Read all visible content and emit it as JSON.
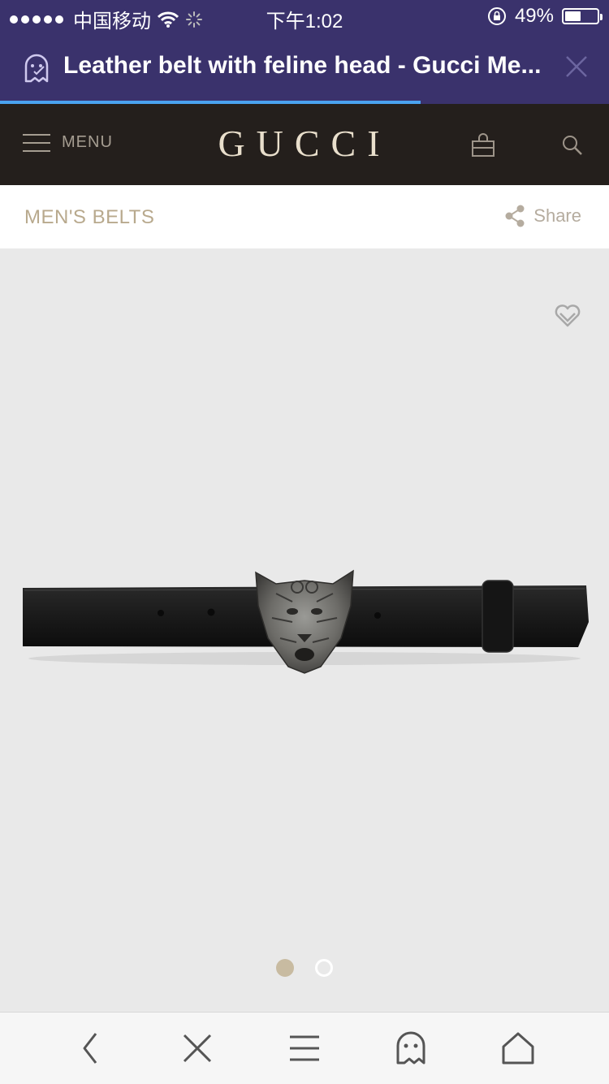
{
  "status_bar": {
    "carrier": "中国移动",
    "time": "下午1:02",
    "battery": "49%",
    "battery_level": 0.49
  },
  "browser": {
    "page_title": "Leather belt with feline head - Gucci Me...",
    "load_progress": 0.69
  },
  "site_nav": {
    "menu_label": "MENU",
    "logo_text": "GUCCI"
  },
  "category": {
    "breadcrumb": "MEN'S BELTS",
    "share_label": "Share"
  },
  "product": {
    "image_count": 2,
    "active_image": 1
  },
  "colors": {
    "browser_bar": "#3a326c",
    "nav_bar": "#241f1c",
    "accent_gold": "#b8a98d",
    "progress": "#4aa3f0"
  },
  "icons": [
    "wifi-icon",
    "loading-icon",
    "rotation-lock-icon",
    "battery-icon",
    "ghost-icon",
    "close-icon",
    "hamburger-icon",
    "shopping-bag-icon",
    "search-icon",
    "share-icon",
    "heart-icon",
    "back-icon",
    "close-tab-icon",
    "menu-icon",
    "ghost-icon",
    "home-icon"
  ]
}
